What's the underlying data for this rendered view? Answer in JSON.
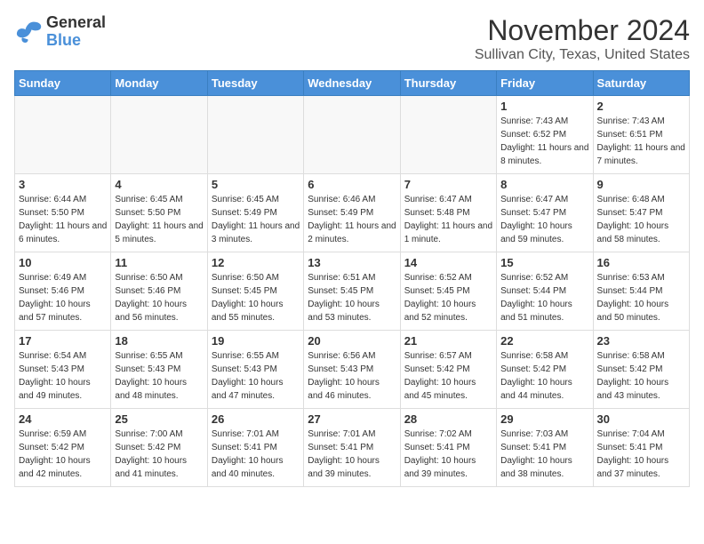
{
  "header": {
    "logo_line1": "General",
    "logo_line2": "Blue",
    "month": "November 2024",
    "location": "Sullivan City, Texas, United States"
  },
  "days_of_week": [
    "Sunday",
    "Monday",
    "Tuesday",
    "Wednesday",
    "Thursday",
    "Friday",
    "Saturday"
  ],
  "weeks": [
    [
      {
        "day": "",
        "sunrise": "",
        "sunset": "",
        "daylight": "",
        "empty": true
      },
      {
        "day": "",
        "sunrise": "",
        "sunset": "",
        "daylight": "",
        "empty": true
      },
      {
        "day": "",
        "sunrise": "",
        "sunset": "",
        "daylight": "",
        "empty": true
      },
      {
        "day": "",
        "sunrise": "",
        "sunset": "",
        "daylight": "",
        "empty": true
      },
      {
        "day": "",
        "sunrise": "",
        "sunset": "",
        "daylight": "",
        "empty": true
      },
      {
        "day": "1",
        "sunrise": "Sunrise: 7:43 AM",
        "sunset": "Sunset: 6:52 PM",
        "daylight": "Daylight: 11 hours and 8 minutes.",
        "empty": false
      },
      {
        "day": "2",
        "sunrise": "Sunrise: 7:43 AM",
        "sunset": "Sunset: 6:51 PM",
        "daylight": "Daylight: 11 hours and 7 minutes.",
        "empty": false
      }
    ],
    [
      {
        "day": "3",
        "sunrise": "Sunrise: 6:44 AM",
        "sunset": "Sunset: 5:50 PM",
        "daylight": "Daylight: 11 hours and 6 minutes.",
        "empty": false
      },
      {
        "day": "4",
        "sunrise": "Sunrise: 6:45 AM",
        "sunset": "Sunset: 5:50 PM",
        "daylight": "Daylight: 11 hours and 5 minutes.",
        "empty": false
      },
      {
        "day": "5",
        "sunrise": "Sunrise: 6:45 AM",
        "sunset": "Sunset: 5:49 PM",
        "daylight": "Daylight: 11 hours and 3 minutes.",
        "empty": false
      },
      {
        "day": "6",
        "sunrise": "Sunrise: 6:46 AM",
        "sunset": "Sunset: 5:49 PM",
        "daylight": "Daylight: 11 hours and 2 minutes.",
        "empty": false
      },
      {
        "day": "7",
        "sunrise": "Sunrise: 6:47 AM",
        "sunset": "Sunset: 5:48 PM",
        "daylight": "Daylight: 11 hours and 1 minute.",
        "empty": false
      },
      {
        "day": "8",
        "sunrise": "Sunrise: 6:47 AM",
        "sunset": "Sunset: 5:47 PM",
        "daylight": "Daylight: 10 hours and 59 minutes.",
        "empty": false
      },
      {
        "day": "9",
        "sunrise": "Sunrise: 6:48 AM",
        "sunset": "Sunset: 5:47 PM",
        "daylight": "Daylight: 10 hours and 58 minutes.",
        "empty": false
      }
    ],
    [
      {
        "day": "10",
        "sunrise": "Sunrise: 6:49 AM",
        "sunset": "Sunset: 5:46 PM",
        "daylight": "Daylight: 10 hours and 57 minutes.",
        "empty": false
      },
      {
        "day": "11",
        "sunrise": "Sunrise: 6:50 AM",
        "sunset": "Sunset: 5:46 PM",
        "daylight": "Daylight: 10 hours and 56 minutes.",
        "empty": false
      },
      {
        "day": "12",
        "sunrise": "Sunrise: 6:50 AM",
        "sunset": "Sunset: 5:45 PM",
        "daylight": "Daylight: 10 hours and 55 minutes.",
        "empty": false
      },
      {
        "day": "13",
        "sunrise": "Sunrise: 6:51 AM",
        "sunset": "Sunset: 5:45 PM",
        "daylight": "Daylight: 10 hours and 53 minutes.",
        "empty": false
      },
      {
        "day": "14",
        "sunrise": "Sunrise: 6:52 AM",
        "sunset": "Sunset: 5:45 PM",
        "daylight": "Daylight: 10 hours and 52 minutes.",
        "empty": false
      },
      {
        "day": "15",
        "sunrise": "Sunrise: 6:52 AM",
        "sunset": "Sunset: 5:44 PM",
        "daylight": "Daylight: 10 hours and 51 minutes.",
        "empty": false
      },
      {
        "day": "16",
        "sunrise": "Sunrise: 6:53 AM",
        "sunset": "Sunset: 5:44 PM",
        "daylight": "Daylight: 10 hours and 50 minutes.",
        "empty": false
      }
    ],
    [
      {
        "day": "17",
        "sunrise": "Sunrise: 6:54 AM",
        "sunset": "Sunset: 5:43 PM",
        "daylight": "Daylight: 10 hours and 49 minutes.",
        "empty": false
      },
      {
        "day": "18",
        "sunrise": "Sunrise: 6:55 AM",
        "sunset": "Sunset: 5:43 PM",
        "daylight": "Daylight: 10 hours and 48 minutes.",
        "empty": false
      },
      {
        "day": "19",
        "sunrise": "Sunrise: 6:55 AM",
        "sunset": "Sunset: 5:43 PM",
        "daylight": "Daylight: 10 hours and 47 minutes.",
        "empty": false
      },
      {
        "day": "20",
        "sunrise": "Sunrise: 6:56 AM",
        "sunset": "Sunset: 5:43 PM",
        "daylight": "Daylight: 10 hours and 46 minutes.",
        "empty": false
      },
      {
        "day": "21",
        "sunrise": "Sunrise: 6:57 AM",
        "sunset": "Sunset: 5:42 PM",
        "daylight": "Daylight: 10 hours and 45 minutes.",
        "empty": false
      },
      {
        "day": "22",
        "sunrise": "Sunrise: 6:58 AM",
        "sunset": "Sunset: 5:42 PM",
        "daylight": "Daylight: 10 hours and 44 minutes.",
        "empty": false
      },
      {
        "day": "23",
        "sunrise": "Sunrise: 6:58 AM",
        "sunset": "Sunset: 5:42 PM",
        "daylight": "Daylight: 10 hours and 43 minutes.",
        "empty": false
      }
    ],
    [
      {
        "day": "24",
        "sunrise": "Sunrise: 6:59 AM",
        "sunset": "Sunset: 5:42 PM",
        "daylight": "Daylight: 10 hours and 42 minutes.",
        "empty": false
      },
      {
        "day": "25",
        "sunrise": "Sunrise: 7:00 AM",
        "sunset": "Sunset: 5:42 PM",
        "daylight": "Daylight: 10 hours and 41 minutes.",
        "empty": false
      },
      {
        "day": "26",
        "sunrise": "Sunrise: 7:01 AM",
        "sunset": "Sunset: 5:41 PM",
        "daylight": "Daylight: 10 hours and 40 minutes.",
        "empty": false
      },
      {
        "day": "27",
        "sunrise": "Sunrise: 7:01 AM",
        "sunset": "Sunset: 5:41 PM",
        "daylight": "Daylight: 10 hours and 39 minutes.",
        "empty": false
      },
      {
        "day": "28",
        "sunrise": "Sunrise: 7:02 AM",
        "sunset": "Sunset: 5:41 PM",
        "daylight": "Daylight: 10 hours and 39 minutes.",
        "empty": false
      },
      {
        "day": "29",
        "sunrise": "Sunrise: 7:03 AM",
        "sunset": "Sunset: 5:41 PM",
        "daylight": "Daylight: 10 hours and 38 minutes.",
        "empty": false
      },
      {
        "day": "30",
        "sunrise": "Sunrise: 7:04 AM",
        "sunset": "Sunset: 5:41 PM",
        "daylight": "Daylight: 10 hours and 37 minutes.",
        "empty": false
      }
    ]
  ]
}
